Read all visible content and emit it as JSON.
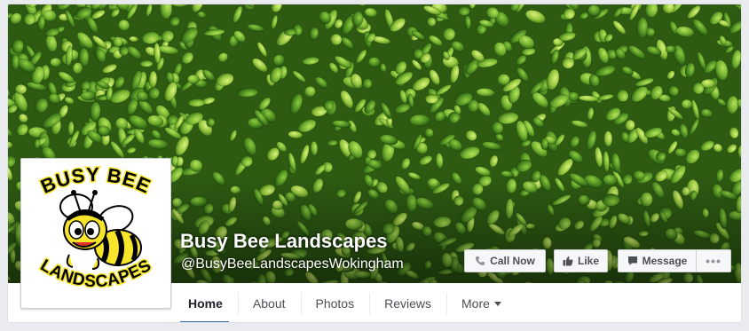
{
  "page": {
    "name": "Busy Bee Landscapes",
    "handle": "@BusyBeeLandscapesWokingham"
  },
  "logo": {
    "top_text": "BUSY BEE",
    "bottom_text": "LANDSCAPES",
    "accent_color": "#f7e52b"
  },
  "actions": {
    "call_label": "Call Now",
    "like_label": "Like",
    "message_label": "Message",
    "more_label": "•••"
  },
  "tabs": [
    {
      "label": "Home",
      "active": true
    },
    {
      "label": "About",
      "active": false
    },
    {
      "label": "Photos",
      "active": false
    },
    {
      "label": "Reviews",
      "active": false
    },
    {
      "label": "More",
      "active": false
    }
  ],
  "colors": {
    "tab_underline": "#4267b2",
    "background": "#e9ebee",
    "foliage": "#4f8a24"
  },
  "icons": {
    "call": "phone-icon",
    "like": "thumbs-up-icon",
    "message": "message-icon",
    "more_tab": "caret-down-icon"
  }
}
